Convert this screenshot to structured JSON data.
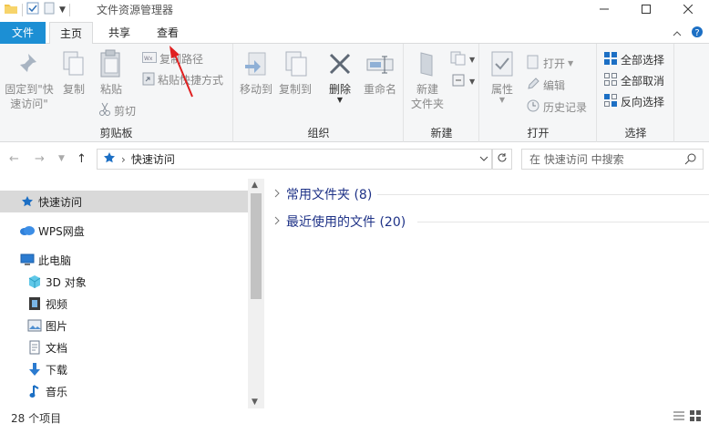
{
  "window": {
    "title": "文件资源管理器",
    "controls": {
      "minimize": "—",
      "maximize": "☐",
      "close": "✕"
    }
  },
  "tabs": {
    "file": "文件",
    "home": "主页",
    "share": "共享",
    "view": "查看"
  },
  "ribbon": {
    "clipboard": {
      "label": "剪贴板",
      "pin_line1": "固定到\"快",
      "pin_line2": "速访问\"",
      "copy": "复制",
      "paste": "粘贴",
      "copy_path": "复制路径",
      "paste_shortcut": "粘贴快捷方式",
      "cut": "剪切"
    },
    "organize": {
      "label": "组织",
      "move_to": "移动到",
      "copy_to": "复制到",
      "delete": "删除",
      "rename": "重命名"
    },
    "new": {
      "label": "新建",
      "new_folder_line1": "新建",
      "new_folder_line2": "文件夹"
    },
    "open": {
      "label": "打开",
      "properties": "属性",
      "open": "打开",
      "edit": "编辑",
      "history": "历史记录"
    },
    "select": {
      "label": "选择",
      "select_all": "全部选择",
      "select_none": "全部取消",
      "invert": "反向选择"
    }
  },
  "address": {
    "path": "快速访问",
    "search_placeholder": "在 快速访问 中搜索"
  },
  "nav": {
    "items": [
      {
        "label": "快速访问",
        "icon": "star-pin-icon"
      },
      {
        "label": "WPS网盘",
        "icon": "cloud-icon"
      },
      {
        "label": "此电脑",
        "icon": "computer-icon"
      },
      {
        "label": "3D 对象",
        "icon": "cube-icon"
      },
      {
        "label": "视频",
        "icon": "film-icon"
      },
      {
        "label": "图片",
        "icon": "picture-icon"
      },
      {
        "label": "文档",
        "icon": "document-icon"
      },
      {
        "label": "下载",
        "icon": "download-arrow-icon"
      },
      {
        "label": "音乐",
        "icon": "music-note-icon"
      }
    ]
  },
  "content": {
    "sections": [
      {
        "label": "常用文件夹 (8)"
      },
      {
        "label": "最近使用的文件 (20)"
      }
    ]
  },
  "status": {
    "count": "28 个项目"
  },
  "colors": {
    "accent": "#1c8fd4",
    "section_text": "#1e3287",
    "annotation_arrow": "#e02020"
  }
}
